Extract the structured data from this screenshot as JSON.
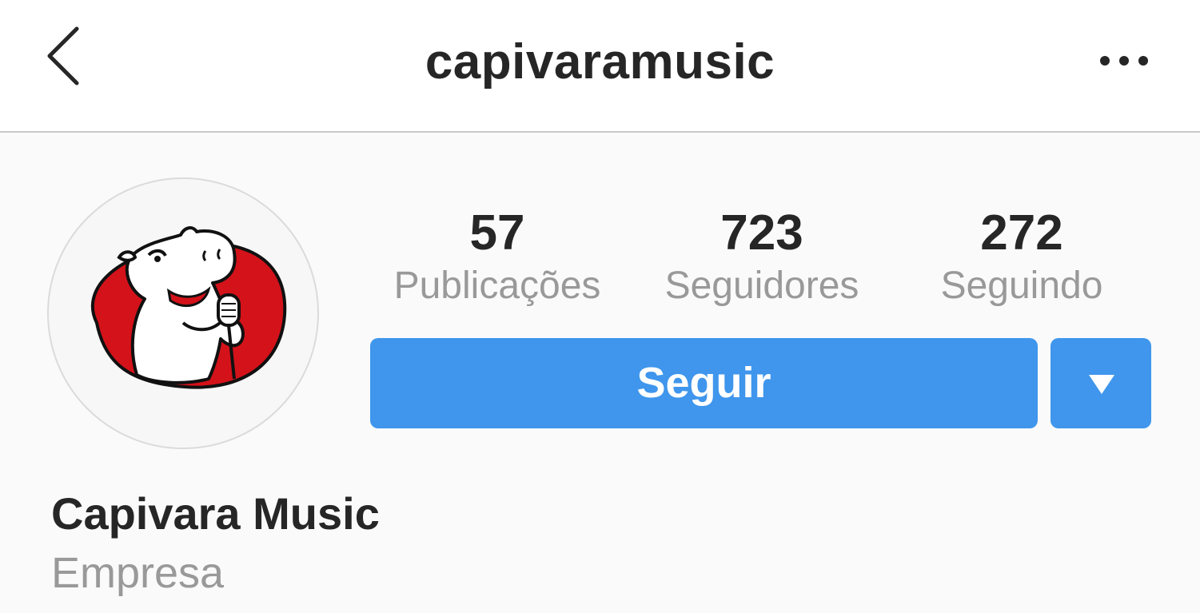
{
  "header": {
    "username": "capivaramusic",
    "back_icon": "chevron-left-icon",
    "more_icon": "more-horizontal-icon"
  },
  "profile": {
    "avatar_icon": "capybara-singer-logo",
    "full_name": "Capivara Music",
    "category": "Empresa"
  },
  "stats": {
    "posts": {
      "value": "57",
      "label": "Publicações"
    },
    "followers": {
      "value": "723",
      "label": "Seguidores"
    },
    "following": {
      "value": "272",
      "label": "Seguindo"
    }
  },
  "actions": {
    "follow_label": "Seguir",
    "dropdown_icon": "caret-down-icon"
  },
  "colors": {
    "accent": "#3f96ec",
    "logo_red": "#d4121a",
    "text_primary": "#262626",
    "text_secondary": "#999999"
  }
}
